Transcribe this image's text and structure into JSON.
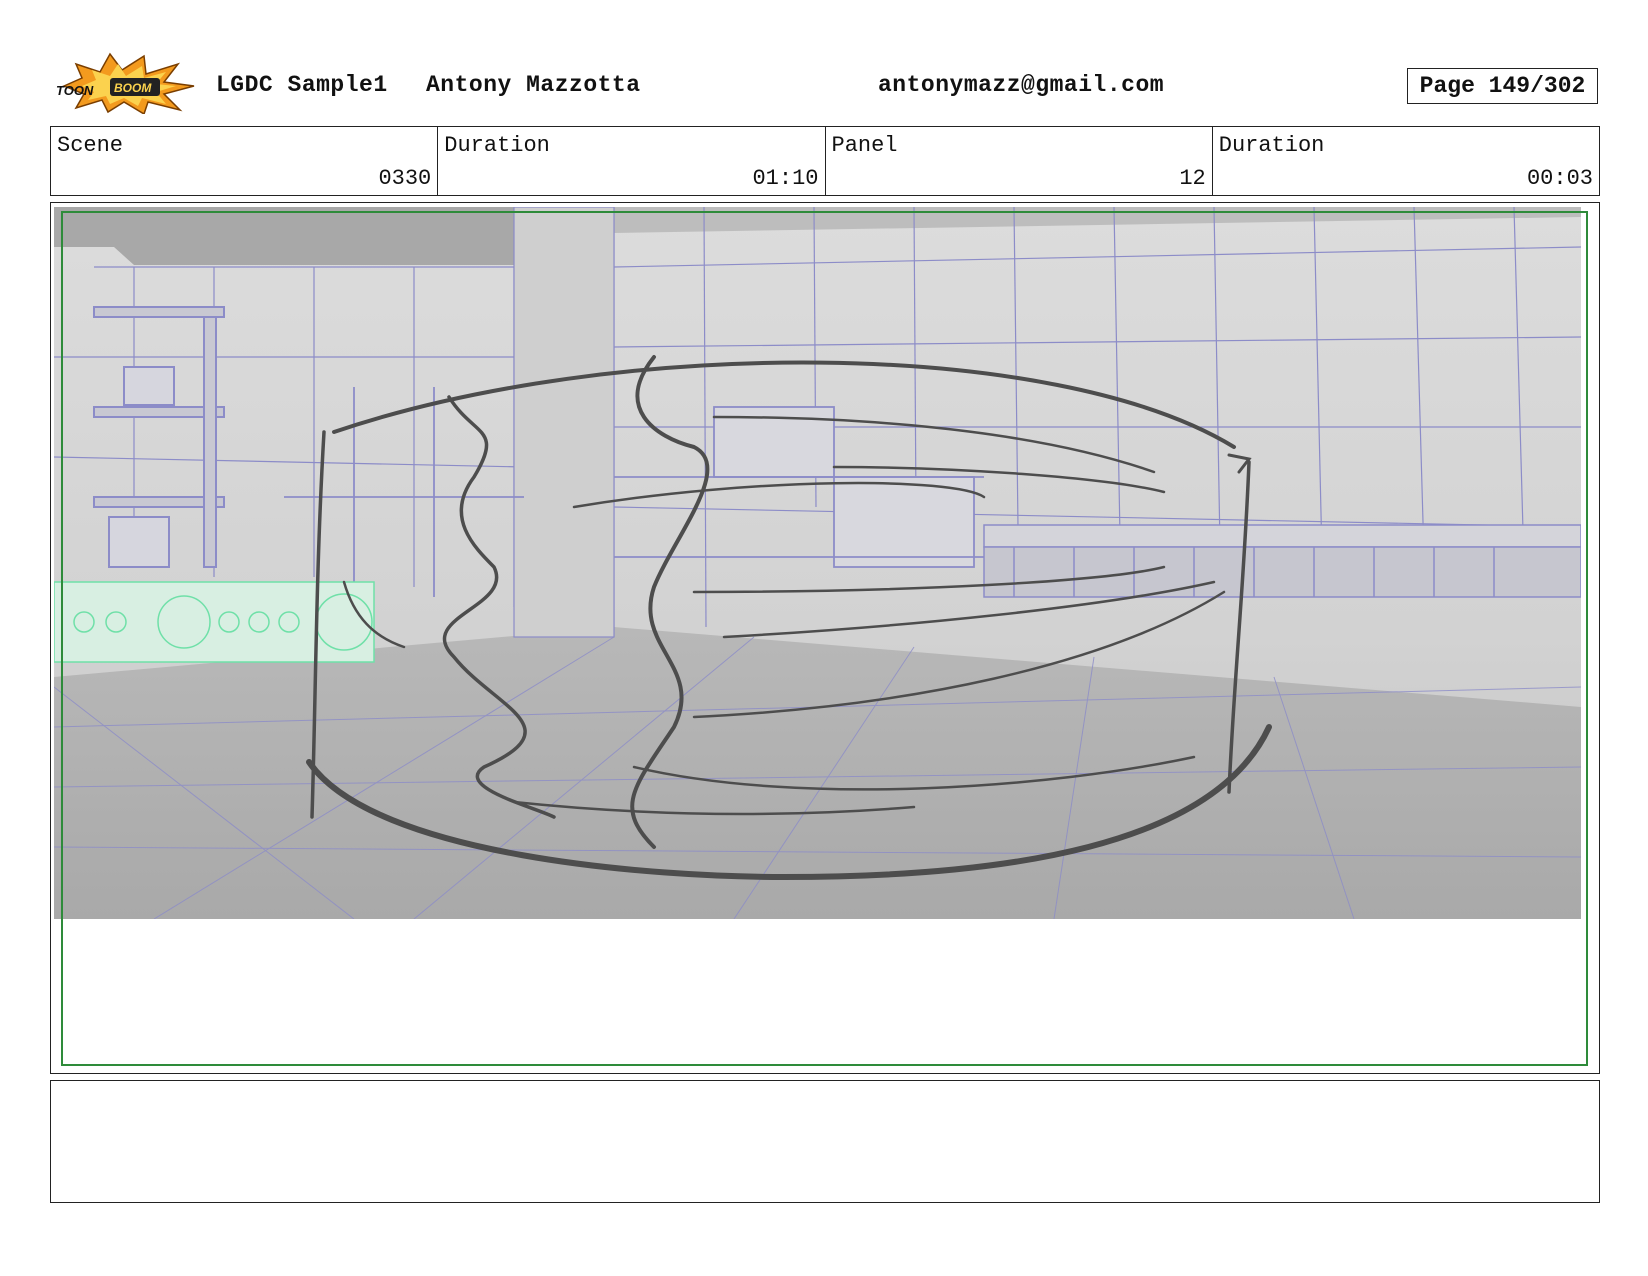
{
  "header": {
    "logo_text_left": "TOON",
    "logo_text_right": "BOOM",
    "project": "LGDC Sample1",
    "author": "Antony Mazzotta",
    "email": "antonymazz@gmail.com",
    "page": "Page 149/302"
  },
  "info": {
    "scene_label": "Scene",
    "scene_value": "0330",
    "scene_duration_label": "Duration",
    "scene_duration_value": "01:10",
    "panel_label": "Panel",
    "panel_value": "12",
    "panel_duration_label": "Duration",
    "panel_duration_value": "00:03"
  },
  "colors": {
    "safe_frame": "#2e8b3a",
    "wireframe": "#8c8cc8",
    "sketch": "#4d4d4d",
    "logo_orange": "#f39a1e"
  },
  "notes": {
    "text": ""
  }
}
